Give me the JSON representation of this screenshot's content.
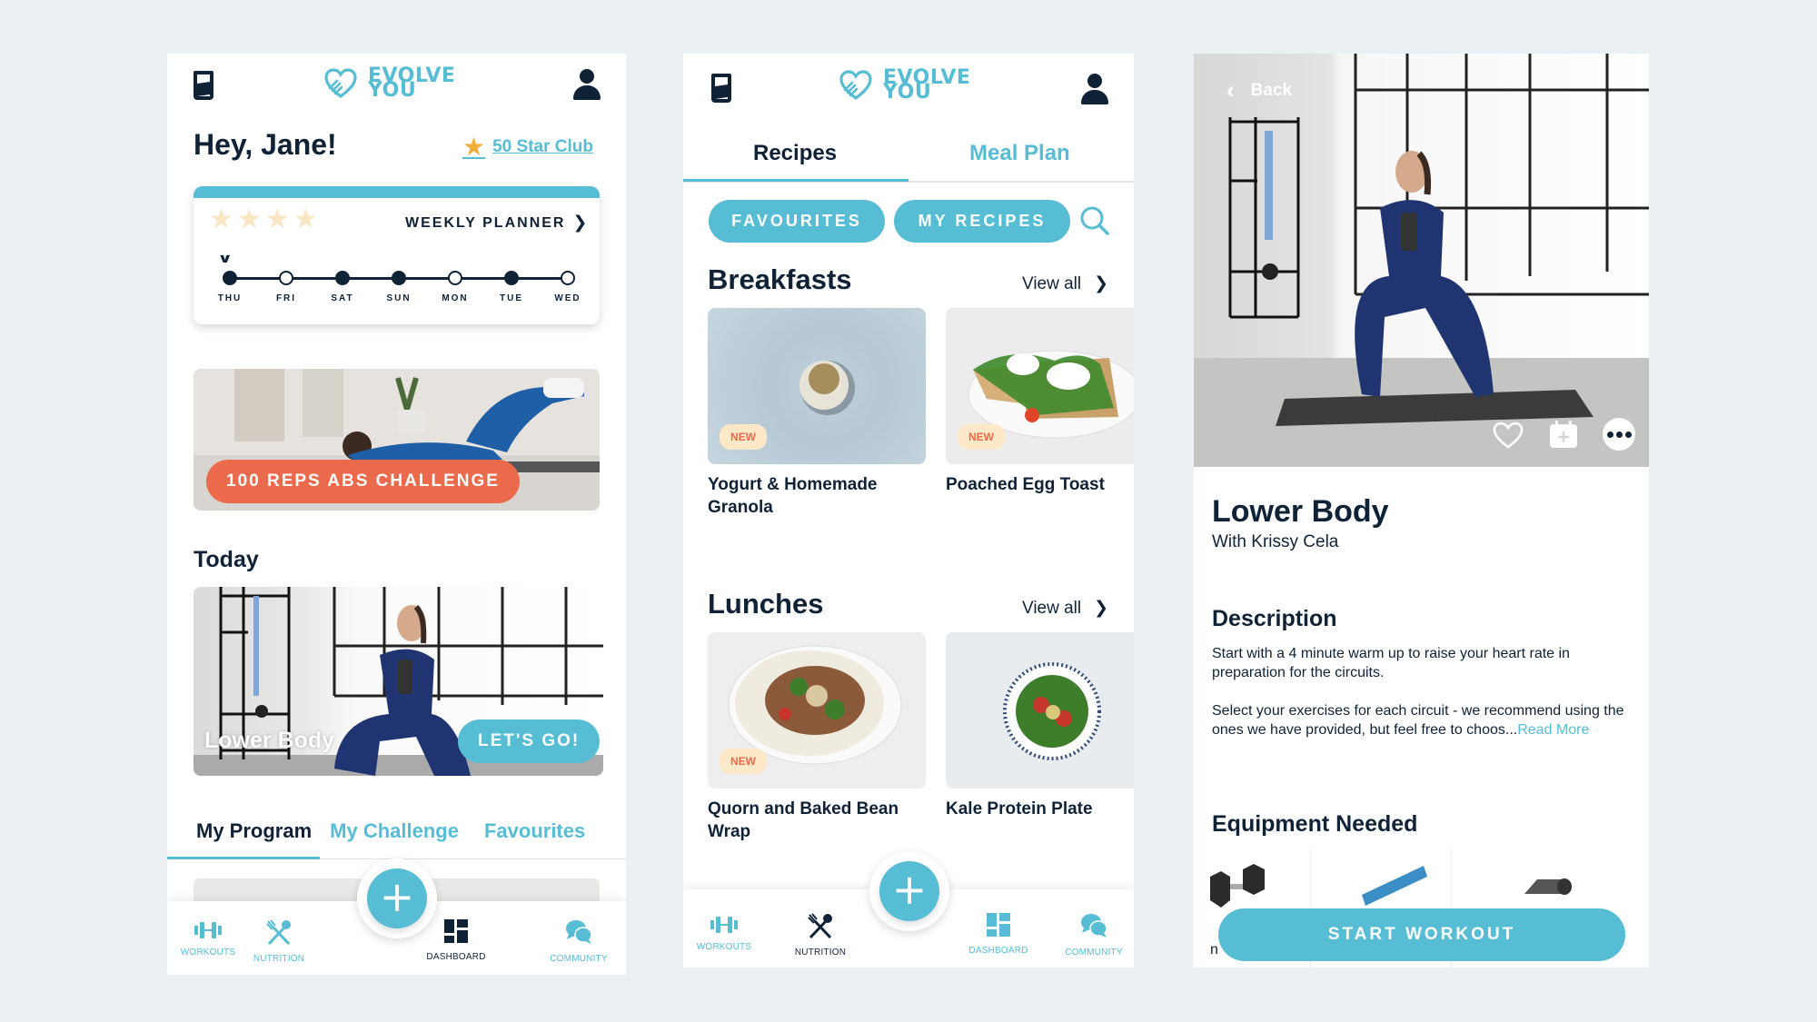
{
  "brand": {
    "line1": "EVOLVE",
    "line2": "YOU",
    "accent": "#56bdd4",
    "navy": "#0f2236",
    "coral": "#ec6a4c"
  },
  "dashboard": {
    "greeting": "Hey, Jane!",
    "star_club": "50 Star Club",
    "weekly_planner": {
      "label": "WEEKLY PLANNER",
      "stars_earned": 0,
      "stars_total": 4,
      "days": [
        {
          "label": "THU",
          "done": true,
          "current": true
        },
        {
          "label": "FRI",
          "done": false
        },
        {
          "label": "SAT",
          "done": true
        },
        {
          "label": "SUN",
          "done": true
        },
        {
          "label": "MON",
          "done": false
        },
        {
          "label": "TUE",
          "done": true
        },
        {
          "label": "WED",
          "done": false
        }
      ]
    },
    "challenge_label": "100 REPS ABS CHALLENGE",
    "today_heading": "Today",
    "today_workout": "Lower Body",
    "lets_go": "LET'S GO!",
    "tabs": [
      {
        "label": "My Program",
        "active": true
      },
      {
        "label": "My Challenge",
        "active": false
      },
      {
        "label": "Favourites",
        "active": false
      }
    ],
    "nav": [
      {
        "label": "WORKOUTS",
        "icon": "dumbbell-icon"
      },
      {
        "label": "NUTRITION",
        "icon": "fork-spoon-icon"
      },
      {
        "label": "DASHBOARD",
        "icon": "dashboard-icon",
        "active": true
      },
      {
        "label": "COMMUNITY",
        "icon": "chat-icon"
      }
    ]
  },
  "nutrition": {
    "tabs": [
      {
        "label": "Recipes",
        "active": true
      },
      {
        "label": "Meal Plan",
        "active": false
      }
    ],
    "chips": [
      "FAVOURITES",
      "MY RECIPES"
    ],
    "view_all": "View all",
    "sections": [
      {
        "title": "Breakfasts",
        "cards": [
          {
            "title": "Yogurt & Homemade Granola",
            "badge": "NEW"
          },
          {
            "title": "Poached Egg Toast",
            "badge": "NEW"
          }
        ]
      },
      {
        "title": "Lunches",
        "cards": [
          {
            "title": "Quorn and Baked Bean Wrap",
            "badge": "NEW"
          },
          {
            "title": "Kale Protein Plate",
            "badge": ""
          }
        ]
      }
    ],
    "nav": [
      {
        "label": "WORKOUTS",
        "icon": "dumbbell-icon"
      },
      {
        "label": "NUTRITION",
        "icon": "fork-spoon-icon",
        "active": true
      },
      {
        "label": "DASHBOARD",
        "icon": "dashboard-icon"
      },
      {
        "label": "COMMUNITY",
        "icon": "chat-icon"
      }
    ]
  },
  "workout": {
    "back": "Back",
    "title": "Lower Body",
    "trainer": "With Krissy Cela",
    "description_heading": "Description",
    "description_p1": "Start with a 4 minute warm up to raise your heart rate in preparation for the circuits.",
    "description_p2": "Select your exercises for each circuit - we recommend using the ones we have provided, but feel free to choos...",
    "read_more": "Read More",
    "equipment_heading": "Equipment Needed",
    "equipment": [
      "dumbbells",
      "resistance band",
      "yoga mat"
    ],
    "equipment_partial_label": "n",
    "start": "START WORKOUT"
  }
}
